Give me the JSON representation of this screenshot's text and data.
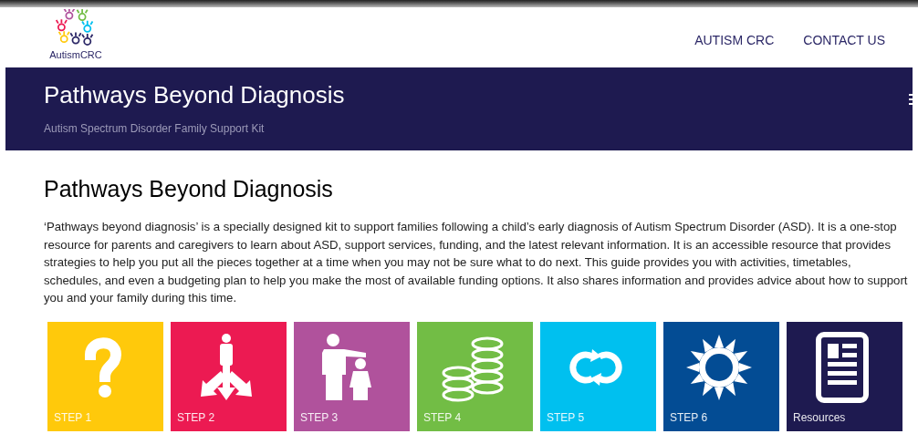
{
  "header": {
    "logo_text": "AutismCRC",
    "nav": [
      {
        "label": "AUTISM CRC"
      },
      {
        "label": "CONTACT US"
      }
    ]
  },
  "banner": {
    "title": "Pathways Beyond Diagnosis",
    "subtitle": "Autism Spectrum Disorder Family Support Kit"
  },
  "main": {
    "heading": "Pathways Beyond Diagnosis",
    "intro": "‘Pathways beyond diagnosis’ is a specially designed kit to support families following a child’s early diagnosis of Autism Spectrum Disorder (ASD). It is a one-stop resource for parents and caregivers to learn about ASD, support services, funding, and the latest relevant information. It is an accessible resource that provides strategies to help you put all the pieces together at a time when you may not be sure what to do next. This guide provides you with activities, timetables, schedules, and even a budgeting plan to help you make the most of available funding options. It also shares information and provides advice about how to support you and your family during this time.",
    "tiles": [
      {
        "label": "STEP 1",
        "kind": "question",
        "color": "#ffc90b"
      },
      {
        "label": "STEP 2",
        "kind": "directions",
        "color": "#ec1a52"
      },
      {
        "label": "STEP 3",
        "kind": "parent",
        "color": "#b0529c"
      },
      {
        "label": "STEP 4",
        "kind": "coins",
        "color": "#72bd45"
      },
      {
        "label": "STEP 5",
        "kind": "cycle",
        "color": "#00c0ef"
      },
      {
        "label": "STEP 6",
        "kind": "sun",
        "color": "#034c94"
      },
      {
        "label": "Resources",
        "kind": "document",
        "color": "#1e1a50"
      }
    ]
  }
}
